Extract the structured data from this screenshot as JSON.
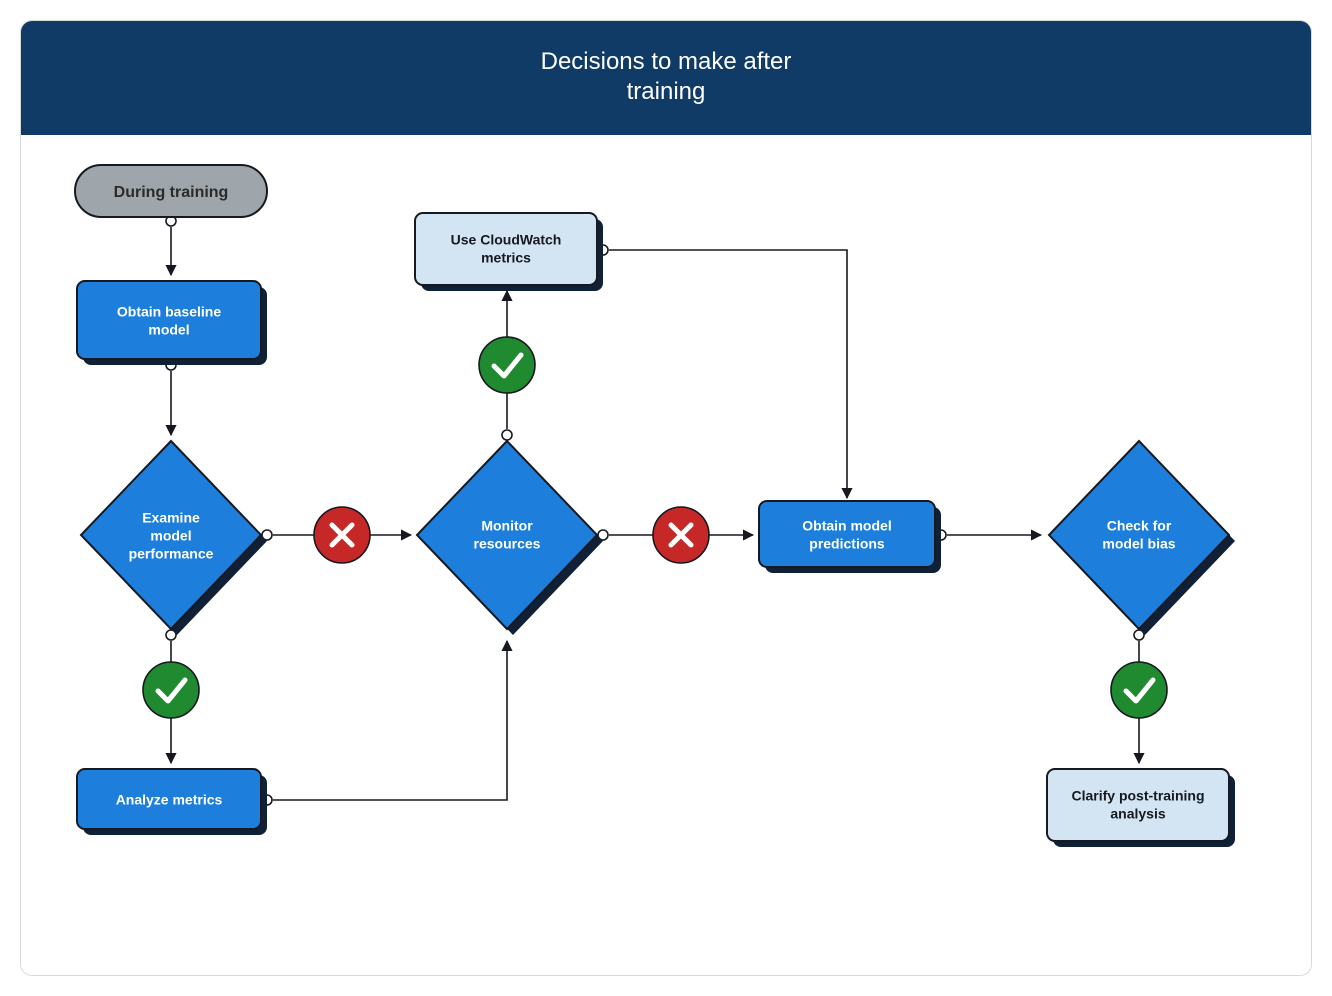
{
  "header": {
    "title_line1": "Decisions to make after",
    "title_line2": "training"
  },
  "nodes": {
    "during_training": "During training",
    "obtain_baseline_l1": "Obtain baseline",
    "obtain_baseline_l2": "model",
    "examine_l1": "Examine",
    "examine_l2": "model",
    "examine_l3": "performance",
    "analyze_metrics": "Analyze metrics",
    "monitor_l1": "Monitor",
    "monitor_l2": "resources",
    "cloudwatch_l1": "Use CloudWatch",
    "cloudwatch_l2": "metrics",
    "obtain_pred_l1": "Obtain model",
    "obtain_pred_l2": "predictions",
    "check_bias_l1": "Check for",
    "check_bias_l2": "model bias",
    "clarify_l1": "Clarify post-training",
    "clarify_l2": "analysis"
  },
  "colors": {
    "header_bg": "#0f3b66",
    "blue_node": "#1d7fdb",
    "light_node": "#d3e5f3",
    "pill": "#9ea6ab",
    "shadow": "#102037",
    "stroke": "#16191f",
    "green": "#1f8a2f",
    "red": "#c62828"
  }
}
